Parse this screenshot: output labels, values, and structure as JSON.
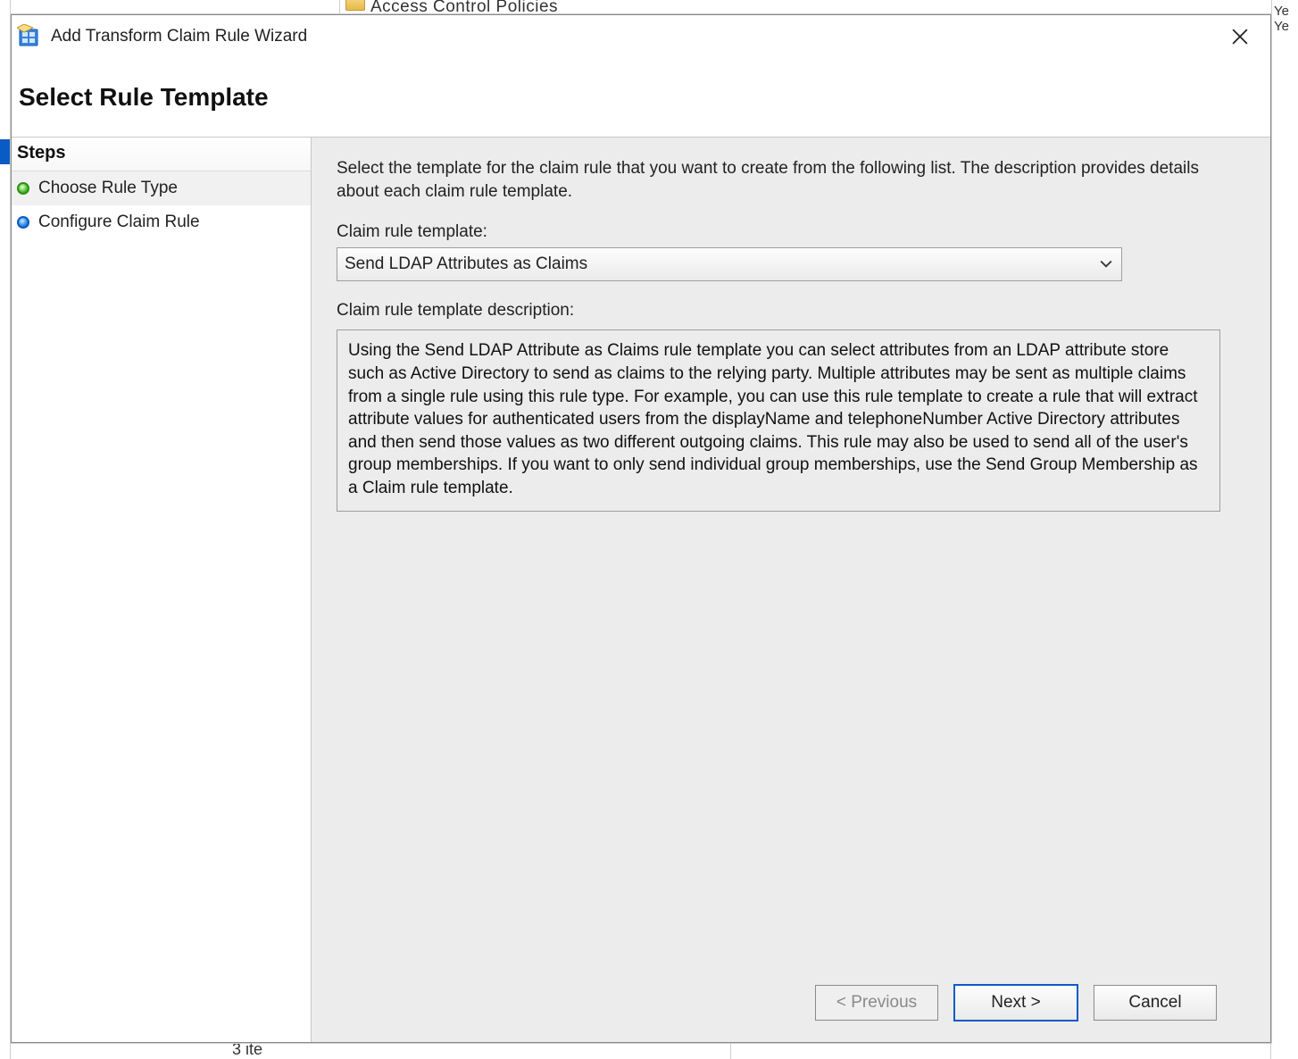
{
  "background": {
    "tree_node": "Access Control Policies",
    "right_fragment_1": "Ye",
    "right_fragment_2": "Ye",
    "status_fragment": "3 ite"
  },
  "dialog": {
    "title": "Add Transform Claim Rule Wizard",
    "header": "Select Rule Template",
    "steps_label": "Steps",
    "steps": [
      {
        "label": "Choose Rule Type",
        "bullet": "green",
        "active": true
      },
      {
        "label": "Configure Claim Rule",
        "bullet": "blue",
        "active": false
      }
    ],
    "instruction": "Select the template for the claim rule that you want to create from the following list. The description provides details about each claim rule template.",
    "template_label": "Claim rule template:",
    "template_selected": "Send LDAP Attributes as Claims",
    "desc_label": "Claim rule template description:",
    "desc_text": "Using the Send LDAP Attribute as Claims rule template you can select attributes from an LDAP attribute store such as Active Directory to send as claims to the relying party. Multiple attributes may be sent as multiple claims from a single rule using this rule type. For example, you can use this rule template to create a rule that will extract attribute values for authenticated users from the displayName and telephoneNumber Active Directory attributes and then send those values as two different outgoing claims. This rule may also be used to send all of the user's group memberships. If you want to only send individual group memberships, use the Send Group Membership as a Claim rule template.",
    "buttons": {
      "previous": "< Previous",
      "next": "Next >",
      "cancel": "Cancel"
    }
  }
}
